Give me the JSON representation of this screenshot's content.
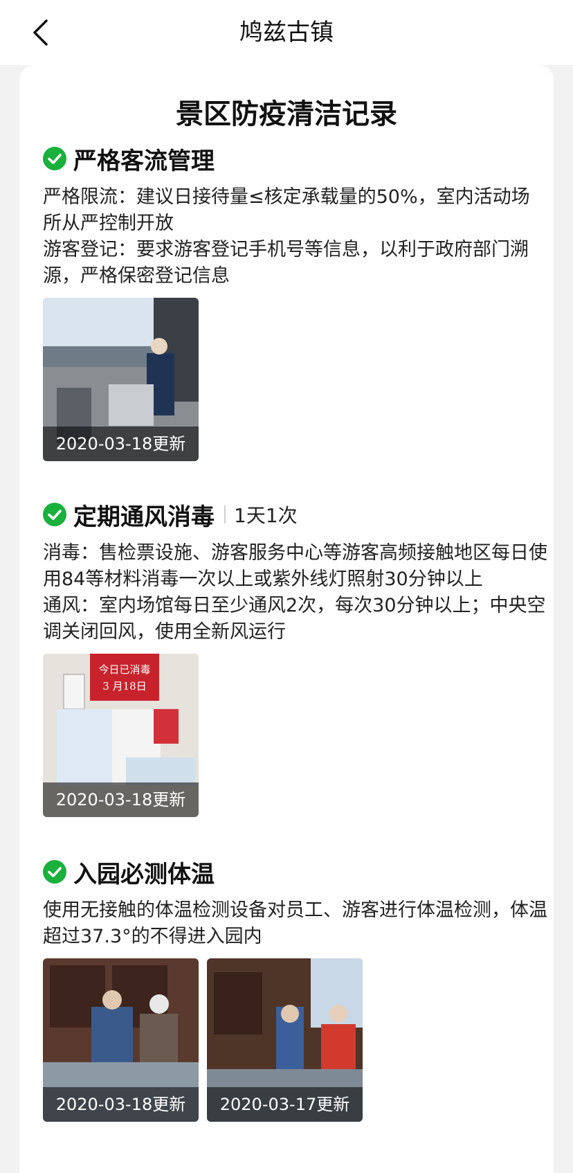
{
  "header": {
    "title": "鸠兹古镇",
    "back_icon": "chevron-left-icon"
  },
  "card": {
    "title": "景区防疫清洁记录"
  },
  "colors": {
    "check": "#19b03c",
    "accent_text": "#1a1a1a"
  },
  "sections": [
    {
      "title": "严格客流管理",
      "frequency": "",
      "paragraphs": [
        "严格限流：建议日接待量≤核定承载量的50%，室内活动场所从严控制开放",
        "游客登记：要求游客登记手机号等信息，以利于政府部门溯源，严格保密登记信息"
      ],
      "photos": [
        {
          "caption": "2020-03-18更新"
        }
      ]
    },
    {
      "title": "定期通风消毒",
      "frequency": "1天1次",
      "paragraphs": [
        "消毒：售检票设施、游客服务中心等游客高频接触地区每日使用84等材料消毒一次以上或紫外线灯照射30分钟以上",
        "通风：室内场馆每日至少通风2次，每次30分钟以上；中央空调关闭回风，使用全新风运行"
      ],
      "photos": [
        {
          "caption": "2020-03-18更新",
          "sign_text": "今日已消毒 3月18日"
        }
      ]
    },
    {
      "title": "入园必测体温",
      "frequency": "",
      "paragraphs": [
        "使用无接触的体温检测设备对员工、游客进行体温检测，体温超过37.3°的不得进入园内"
      ],
      "photos": [
        {
          "caption": "2020-03-18更新"
        },
        {
          "caption": "2020-03-17更新"
        }
      ]
    }
  ]
}
